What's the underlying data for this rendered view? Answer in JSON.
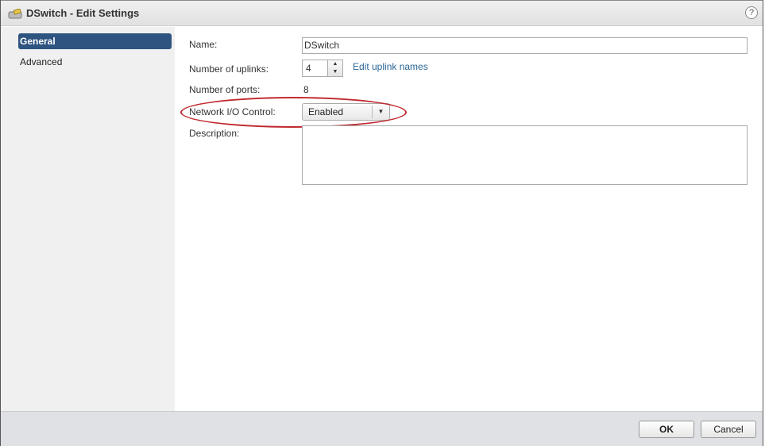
{
  "window": {
    "title": "DSwitch - Edit Settings",
    "help": "?"
  },
  "sidebar": {
    "items": [
      {
        "label": "General",
        "selected": true
      },
      {
        "label": "Advanced",
        "selected": false
      }
    ]
  },
  "form": {
    "name_label": "Name:",
    "name_value": "DSwitch",
    "uplinks_label": "Number of uplinks:",
    "uplinks_value": "4",
    "edit_uplinks_link": "Edit uplink names",
    "ports_label": "Number of ports:",
    "ports_value": "8",
    "nioc_label": "Network I/O Control:",
    "nioc_value": "Enabled",
    "description_label": "Description:",
    "description_value": ""
  },
  "footer": {
    "ok": "OK",
    "cancel": "Cancel"
  },
  "colors": {
    "accent": "#2e5480",
    "annotation": "#c0282e"
  }
}
